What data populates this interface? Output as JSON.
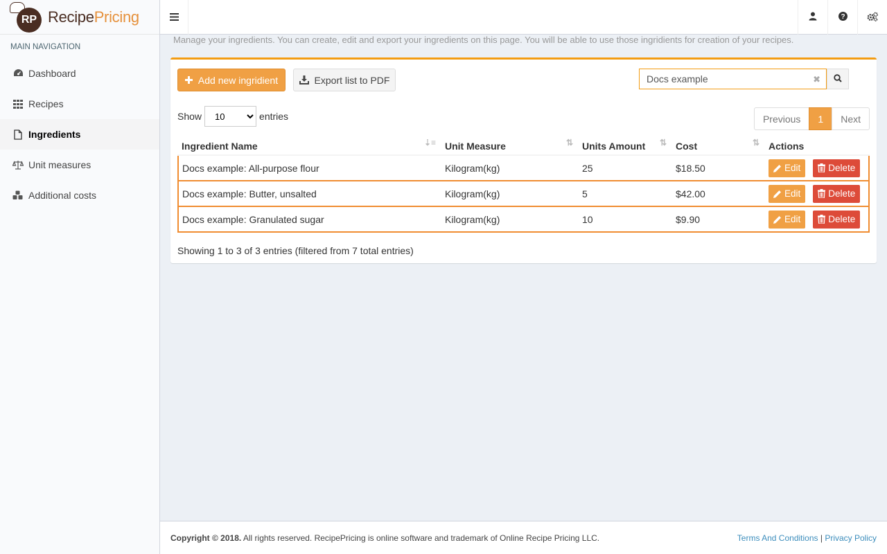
{
  "brand": {
    "logo_initials": "RP",
    "name_part1": "Recipe",
    "name_part2": "Pricing"
  },
  "sidebar": {
    "header": "MAIN NAVIGATION",
    "items": [
      {
        "label": "Dashboard",
        "icon": "dashboard-icon"
      },
      {
        "label": "Recipes",
        "icon": "grid-icon"
      },
      {
        "label": "Ingredients",
        "icon": "file-icon",
        "active": true
      },
      {
        "label": "Unit measures",
        "icon": "scale-icon"
      },
      {
        "label": "Additional costs",
        "icon": "cubes-icon"
      }
    ]
  },
  "intro": "Manage your ingredients. You can create, edit and export your ingredients on this page. You will be able to use those ingridients for creation of your recipes.",
  "toolbar": {
    "add_label": "Add new ingridient",
    "export_label": "Export list to PDF"
  },
  "search": {
    "value": "Docs example"
  },
  "length": {
    "show": "Show",
    "selected": "10",
    "entries": "entries"
  },
  "pagination": {
    "previous": "Previous",
    "current": "1",
    "next": "Next"
  },
  "table": {
    "columns": [
      "Ingredient Name",
      "Unit Measure",
      "Units Amount",
      "Cost",
      "Actions"
    ],
    "rows": [
      {
        "name": "Docs example: All-purpose flour",
        "unit": "Kilogram(kg)",
        "amount": "25",
        "cost": "$18.50"
      },
      {
        "name": "Docs example: Butter, unsalted",
        "unit": "Kilogram(kg)",
        "amount": "5",
        "cost": "$42.00"
      },
      {
        "name": "Docs example: Granulated sugar",
        "unit": "Kilogram(kg)",
        "amount": "10",
        "cost": "$9.90"
      }
    ],
    "edit_label": "Edit",
    "delete_label": "Delete"
  },
  "info": "Showing 1 to 3 of 3 entries (filtered from 7 total entries)",
  "footer": {
    "copyright": "Copyright © 2018.",
    "rest": " All rights reserved. RecipePricing is online software and trademark of Online Recipe Pricing LLC.",
    "terms": "Terms And Conditions",
    "separator": " | ",
    "privacy": "Privacy Policy"
  },
  "colors": {
    "accent": "#f0a044",
    "danger": "#dd4b39",
    "brand_dark": "#4a2d22"
  }
}
